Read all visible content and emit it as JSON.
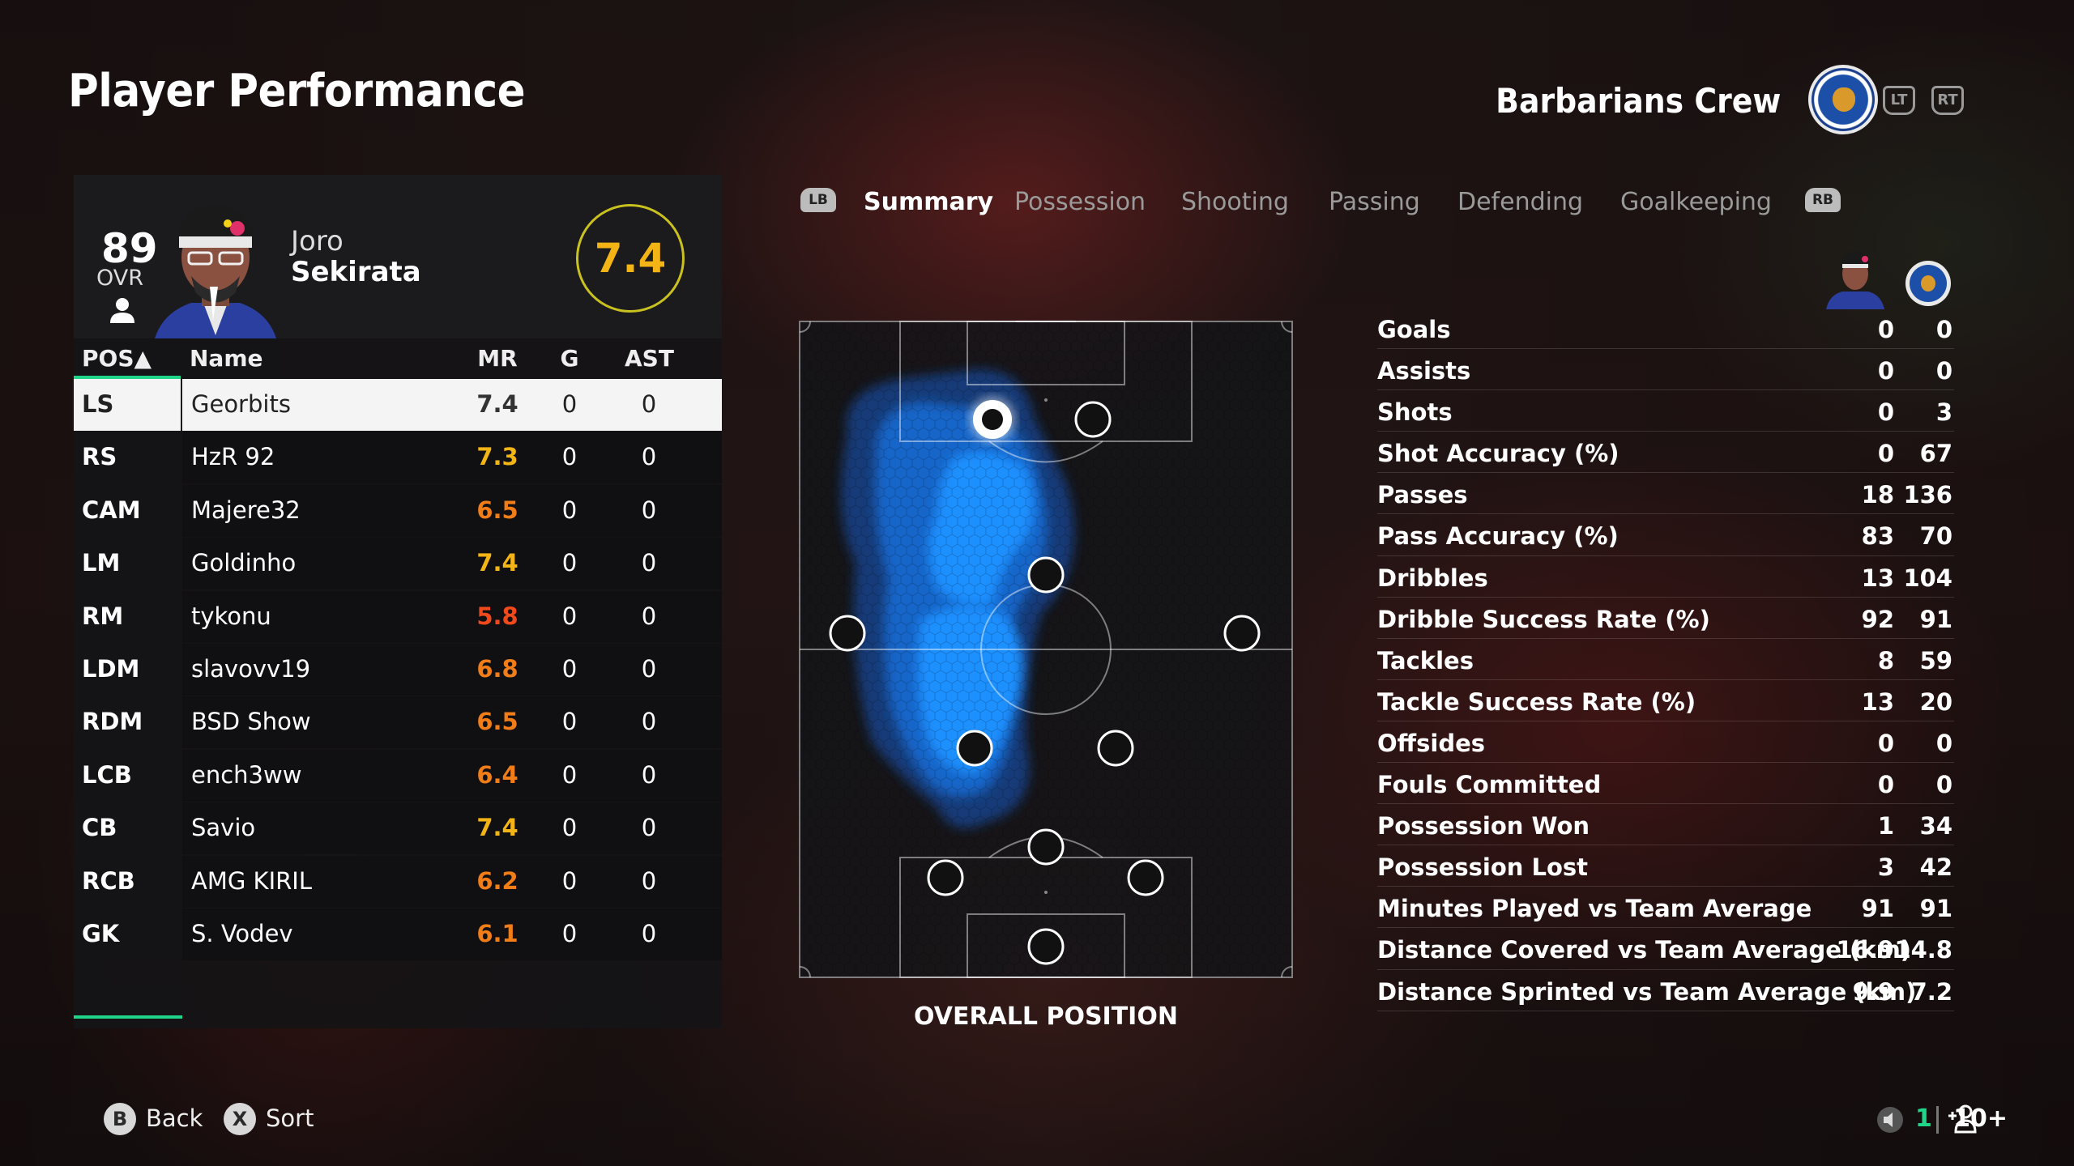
{
  "header": {
    "title": "Player Performance",
    "club_name": "Barbarians Crew",
    "lt_label": "LT",
    "rt_label": "RT"
  },
  "player_card": {
    "ovr": "89",
    "ovr_label": "OVR",
    "first_name": "Joro",
    "last_name": "Sekirata",
    "match_rating": "7.4"
  },
  "table": {
    "headers": {
      "pos": "POS▲",
      "name": "Name",
      "mr": "MR",
      "g": "G",
      "ast": "AST"
    },
    "rows": [
      {
        "pos": "LS",
        "name": "Georbits",
        "mr": "7.4",
        "g": "0",
        "ast": "0"
      },
      {
        "pos": "RS",
        "name": "HzR 92",
        "mr": "7.3",
        "g": "0",
        "ast": "0"
      },
      {
        "pos": "CAM",
        "name": "Majere32",
        "mr": "6.5",
        "g": "0",
        "ast": "0"
      },
      {
        "pos": "LM",
        "name": "Goldinho",
        "mr": "7.4",
        "g": "0",
        "ast": "0"
      },
      {
        "pos": "RM",
        "name": "tykonu",
        "mr": "5.8",
        "g": "0",
        "ast": "0"
      },
      {
        "pos": "LDM",
        "name": "slavovv19",
        "mr": "6.8",
        "g": "0",
        "ast": "0"
      },
      {
        "pos": "RDM",
        "name": "BSD Show",
        "mr": "6.5",
        "g": "0",
        "ast": "0"
      },
      {
        "pos": "LCB",
        "name": "ench3ww",
        "mr": "6.4",
        "g": "0",
        "ast": "0"
      },
      {
        "pos": "CB",
        "name": "Savio",
        "mr": "7.4",
        "g": "0",
        "ast": "0"
      },
      {
        "pos": "RCB",
        "name": "AMG KIRIL",
        "mr": "6.2",
        "g": "0",
        "ast": "0"
      },
      {
        "pos": "GK",
        "name": "S. Vodev",
        "mr": "6.1",
        "g": "0",
        "ast": "0"
      }
    ]
  },
  "tabs": {
    "lb": "LB",
    "rb": "RB",
    "items": [
      "Summary",
      "Possession",
      "Shooting",
      "Passing",
      "Defending",
      "Goalkeeping"
    ],
    "active": "Summary"
  },
  "pitch": {
    "label": "OVERALL POSITION",
    "heat_color": "#1e90ff"
  },
  "stats": [
    {
      "label": "Goals",
      "player": "0",
      "team": "0"
    },
    {
      "label": "Assists",
      "player": "0",
      "team": "0"
    },
    {
      "label": "Shots",
      "player": "0",
      "team": "3"
    },
    {
      "label": "Shot Accuracy (%)",
      "player": "0",
      "team": "67"
    },
    {
      "label": "Passes",
      "player": "18",
      "team": "136"
    },
    {
      "label": "Pass Accuracy (%)",
      "player": "83",
      "team": "70"
    },
    {
      "label": "Dribbles",
      "player": "13",
      "team": "104"
    },
    {
      "label": "Dribble Success Rate (%)",
      "player": "92",
      "team": "91"
    },
    {
      "label": "Tackles",
      "player": "8",
      "team": "59"
    },
    {
      "label": "Tackle Success Rate (%)",
      "player": "13",
      "team": "20"
    },
    {
      "label": "Offsides",
      "player": "0",
      "team": "0"
    },
    {
      "label": "Fouls Committed",
      "player": "0",
      "team": "0"
    },
    {
      "label": "Possession Won",
      "player": "1",
      "team": "34"
    },
    {
      "label": "Possession Lost",
      "player": "3",
      "team": "42"
    },
    {
      "label": "Minutes Played vs Team Average",
      "player": "91",
      "team": "91"
    },
    {
      "label": "Distance Covered vs Team Average (km)",
      "player": "16.9",
      "team": "14.8"
    },
    {
      "label": "Distance Sprinted vs Team Average (km)",
      "player": "9.9",
      "team": "7.2"
    }
  ],
  "footer": {
    "back_button": "B",
    "back_label": "Back",
    "sort_button": "X",
    "sort_label": "Sort",
    "green_count": "1",
    "players_count": "10+"
  },
  "colors": {
    "accent_green": "#1fd58a",
    "rating_yellow": "#f3b415",
    "rating_orange": "#f07d18",
    "rating_red": "#f04a1c"
  }
}
